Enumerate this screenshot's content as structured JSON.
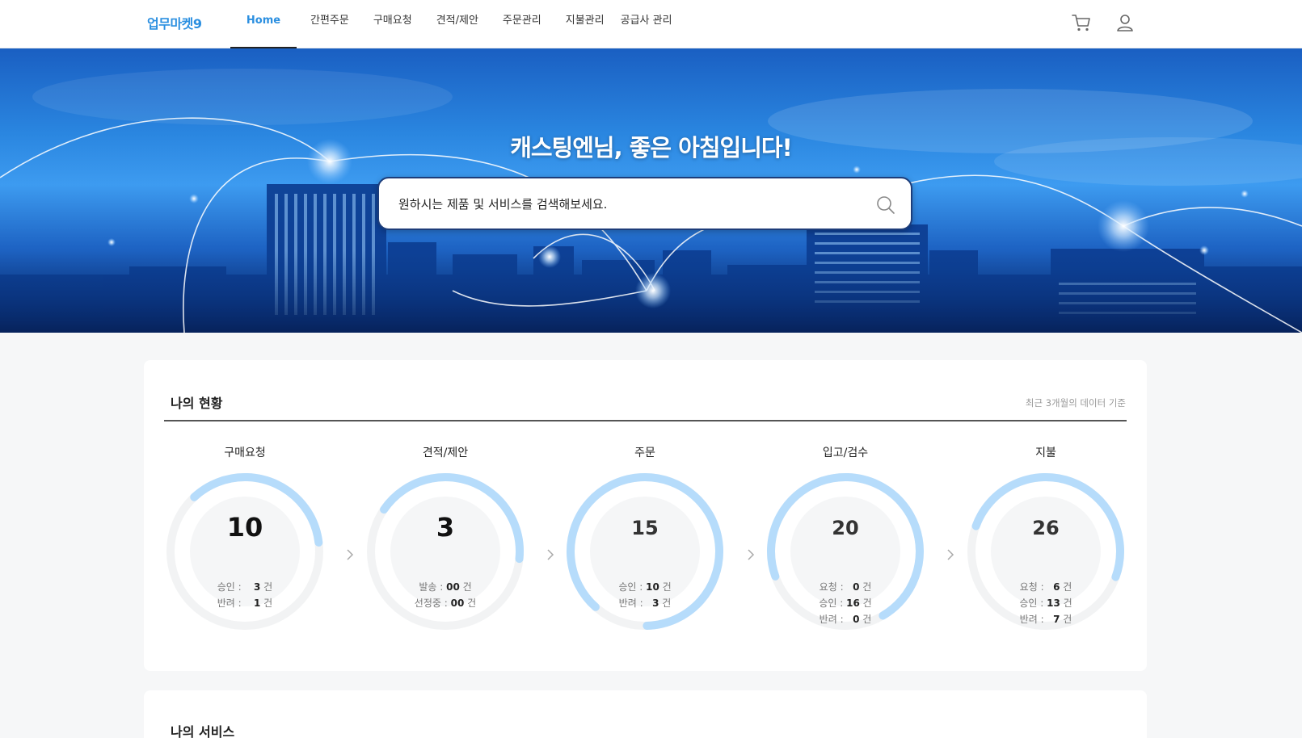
{
  "header": {
    "logo": "업무마켓9",
    "nav": [
      {
        "label": "Home",
        "active": true
      },
      {
        "label": "간편주문"
      },
      {
        "label": "구매요청"
      },
      {
        "label": "견적/제안"
      },
      {
        "label": "주문관리"
      },
      {
        "label": "지불관리"
      },
      {
        "label": "공급사 관리"
      }
    ],
    "icons": [
      "cart-icon",
      "user-icon"
    ]
  },
  "hero": {
    "greeting": "캐스팅엔님, 좋은 아침입니다!",
    "search_placeholder": "원하시는 제품 및 서비스를 검색해보세요."
  },
  "status": {
    "title": "나의 현황",
    "note": "최근 3개월의 데이터 기준",
    "items": [
      {
        "label": "구매요청",
        "value": "10",
        "progress": 0.35,
        "details": [
          {
            "k": "승인 :",
            "v": "3"
          },
          {
            "k": "반려 :",
            "v": "1"
          }
        ]
      },
      {
        "label": "견적/제안",
        "value": "3",
        "progress": 0.42,
        "details": [
          {
            "k": "발송 :",
            "v": "00"
          },
          {
            "k": "선정중 :",
            "v": "00"
          }
        ]
      },
      {
        "label": "주문",
        "value": "15",
        "progress": 0.88,
        "details": [
          {
            "k": "승인 :",
            "v": "10"
          },
          {
            "k": "반려 :",
            "v": "3"
          }
        ]
      },
      {
        "label": "입고/검수",
        "value": "20",
        "progress": 0.72,
        "details": [
          {
            "k": "요청 :",
            "v": "0"
          },
          {
            "k": "승인 :",
            "v": "16"
          },
          {
            "k": "반려 :",
            "v": "0"
          }
        ]
      },
      {
        "label": "지불",
        "value": "26",
        "progress": 0.5,
        "details": [
          {
            "k": "요청 :",
            "v": "6"
          },
          {
            "k": "승인 :",
            "v": "13"
          },
          {
            "k": "반려 :",
            "v": "7"
          }
        ]
      }
    ],
    "unit": "건"
  },
  "services": {
    "title": "나의 서비스"
  },
  "colors": {
    "accent": "#2b8fe0",
    "ring": "#b6dcfb",
    "ring_track": "#f2f3f4"
  }
}
